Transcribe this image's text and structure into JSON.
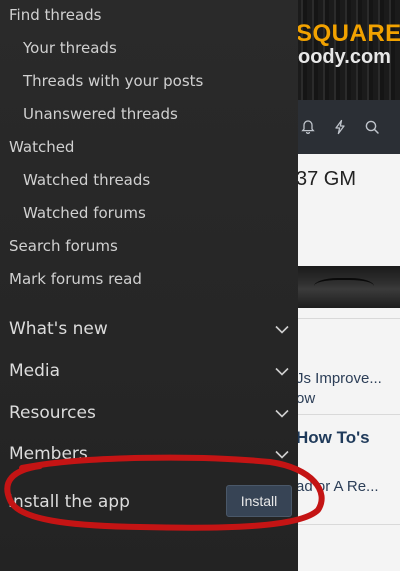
{
  "background": {
    "logo_line1": "SQUARE",
    "logo_line2": "oody.com",
    "time_text": "37 GM",
    "snippet1": "Js Improve...",
    "snippet2": "ow",
    "heading": "How To's",
    "snippet3": "ad or A Re..."
  },
  "menu": {
    "find_threads": "Find threads",
    "your_threads": "Your threads",
    "threads_with_posts": "Threads with your posts",
    "unanswered_threads": "Unanswered threads",
    "watched": "Watched",
    "watched_threads": "Watched threads",
    "watched_forums": "Watched forums",
    "search_forums": "Search forums",
    "mark_forums_read": "Mark forums read",
    "sections": [
      {
        "label": "What's new"
      },
      {
        "label": "Media"
      },
      {
        "label": "Resources"
      },
      {
        "label": "Members"
      }
    ],
    "install_label": "Install the app",
    "install_button": "Install"
  },
  "colors": {
    "menu_bg": "#2a2a2a",
    "install_button_bg": "#374455",
    "annotation": "#c41414",
    "logo_accent": "#f2a200"
  }
}
